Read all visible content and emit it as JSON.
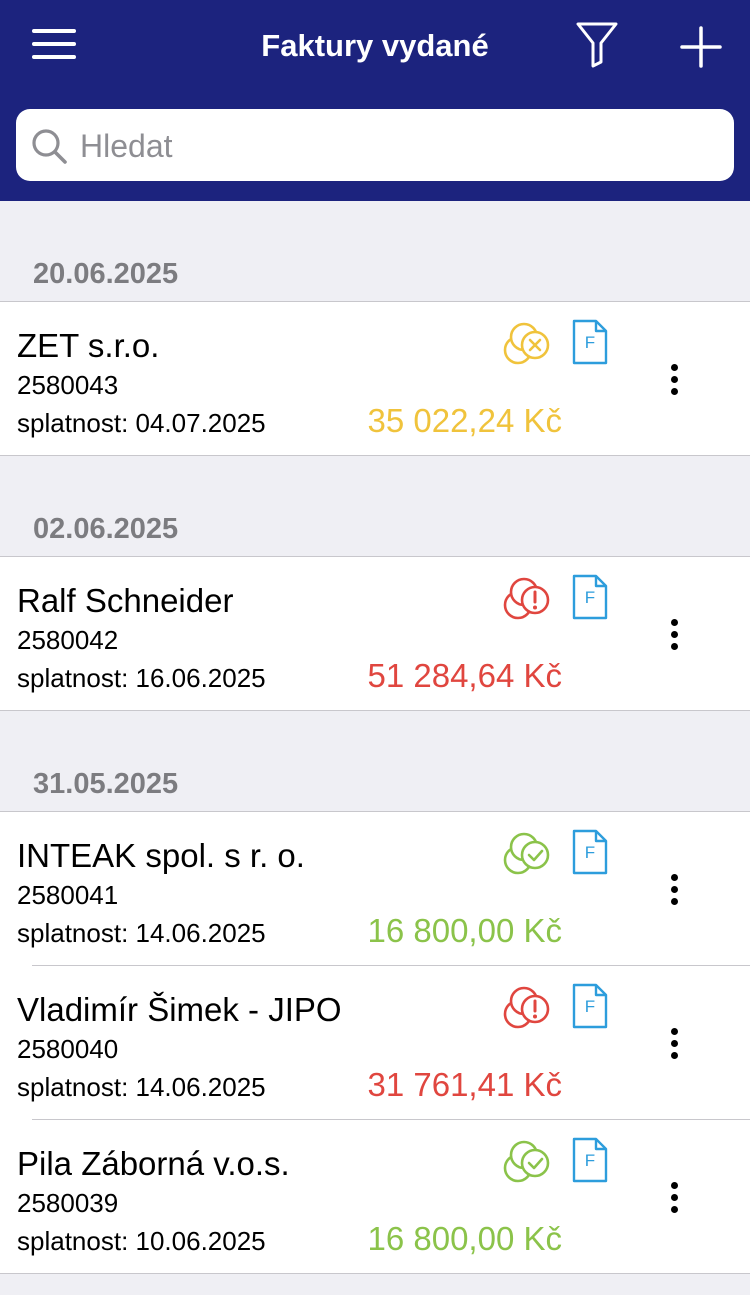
{
  "header": {
    "title": "Faktury vydané",
    "menu_icon": "hamburger-icon",
    "filter_icon": "filter-icon",
    "add_icon": "plus-icon"
  },
  "search": {
    "placeholder": "Hledat",
    "value": ""
  },
  "colors": {
    "header_bg": "#1c237e",
    "status_partial": "#f0c33c",
    "status_overdue": "#e0463f",
    "status_paid": "#8bc34a",
    "document_icon": "#2d9ddc"
  },
  "sections": [
    {
      "date": "20.06.2025",
      "invoices": [
        {
          "customer": "ZET s.r.o.",
          "number": "2580043",
          "due": "splatnost: 04.07.2025",
          "amount": "35 022,24 Kč",
          "status": "partial",
          "status_icon": "coins-x-icon",
          "doc_label": "F"
        }
      ]
    },
    {
      "date": "02.06.2025",
      "invoices": [
        {
          "customer": "Ralf Schneider",
          "number": "2580042",
          "due": "splatnost: 16.06.2025",
          "amount": "51 284,64 Kč",
          "status": "overdue",
          "status_icon": "coins-exclamation-icon",
          "doc_label": "F"
        }
      ]
    },
    {
      "date": "31.05.2025",
      "invoices": [
        {
          "customer": "INTEAK spol. s r. o.",
          "number": "2580041",
          "due": "splatnost: 14.06.2025",
          "amount": "16 800,00 Kč",
          "status": "paid",
          "status_icon": "coins-check-icon",
          "doc_label": "F"
        },
        {
          "customer": "Vladimír Šimek - JIPO",
          "number": "2580040",
          "due": "splatnost: 14.06.2025",
          "amount": "31 761,41 Kč",
          "status": "overdue",
          "status_icon": "coins-exclamation-icon",
          "doc_label": "F"
        },
        {
          "customer": "Pila Záborná v.o.s.",
          "number": "2580039",
          "due": "splatnost: 10.06.2025",
          "amount": "16 800,00 Kč",
          "status": "paid",
          "status_icon": "coins-check-icon",
          "doc_label": "F"
        }
      ]
    }
  ]
}
